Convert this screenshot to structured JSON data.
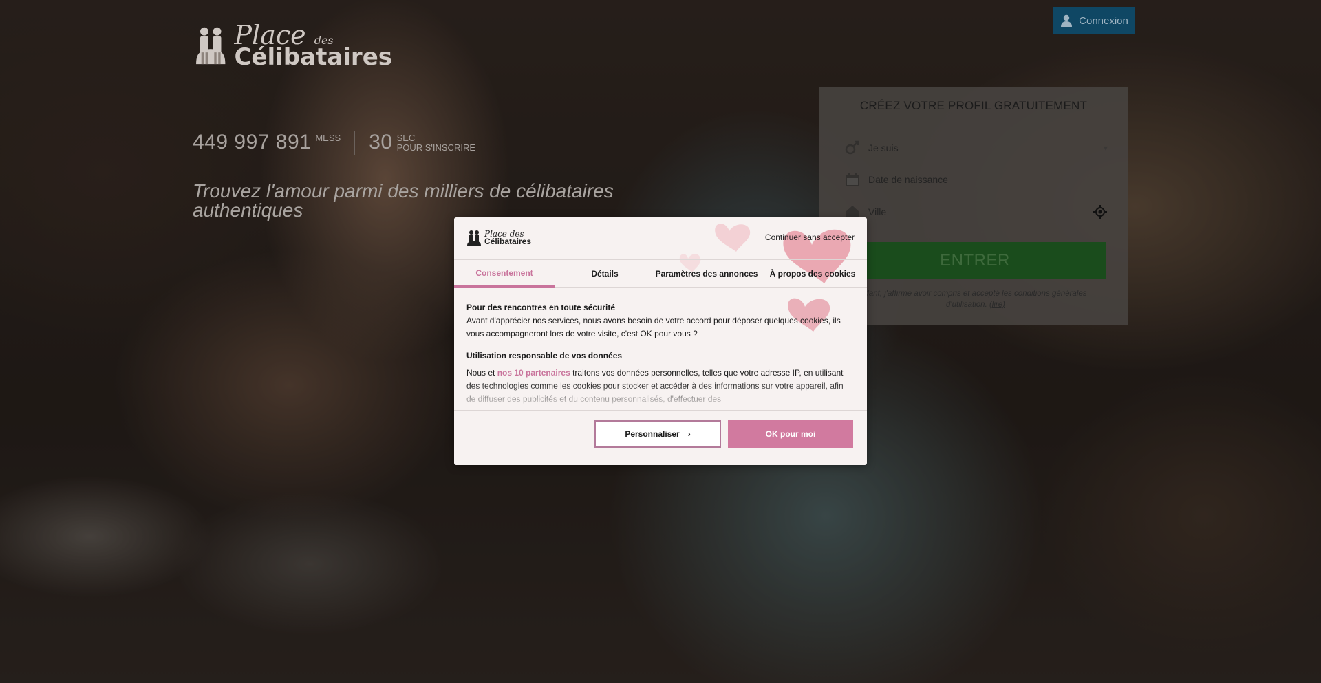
{
  "header": {
    "logo_line1": "Place",
    "logo_line1_small": "des",
    "logo_line2": "Célibataires",
    "login_label": "Connexion"
  },
  "stats": {
    "messages_value": "449 997 891",
    "messages_unit": "MESS",
    "seconds_value": "30",
    "seconds_unit_1": "SEC",
    "seconds_unit_2": "POUR S'INSCRIRE"
  },
  "tagline": "Trouvez l'amour parmi des milliers de célibataires authentiques",
  "signup": {
    "title": "CRÉEZ VOTRE PROFIL GRATUITEMENT",
    "gender_placeholder": "Je suis",
    "birthdate_placeholder": "Date de naissance",
    "city_placeholder": "Ville",
    "enter_label": "ENTRER",
    "legal_text": "dant, j'affirme avoir compris et accepté les conditions générales d'utilisation.",
    "legal_link": "(lire)"
  },
  "cookie_dialog": {
    "logo_line1": "Place des",
    "logo_line2": "Célibataires",
    "skip_label": "Continuer sans accepter",
    "tabs": [
      {
        "label": "Consentement"
      },
      {
        "label": "Détails"
      },
      {
        "label": "Paramètres des annonces"
      },
      {
        "label": "À propos des cookies"
      }
    ],
    "section1_title": "Pour des rencontres en toute sécurité",
    "section1_text": "Avant d'apprécier nos services, nous avons besoin de votre accord pour déposer quelques cookies, ils vous accompagneront lors de votre visite, c'est OK pour vous ?",
    "section2_title": "Utilisation responsable de vos données",
    "section2_prefix": "Nous et ",
    "section2_link": "nos 10 partenaires",
    "section2_text": " traitons vos données personnelles, telles que votre adresse IP, en utilisant des technologies comme les cookies pour stocker et accéder à des informations sur votre appareil, afin de diffuser des publicités et du contenu personnalisés, d'effectuer des",
    "customize_label": "Personnaliser",
    "ok_label": "OK pour moi"
  },
  "colors": {
    "accent_pink": "#d17a9f",
    "login_blue": "#0f4764",
    "enter_green": "#1a4c1c"
  }
}
